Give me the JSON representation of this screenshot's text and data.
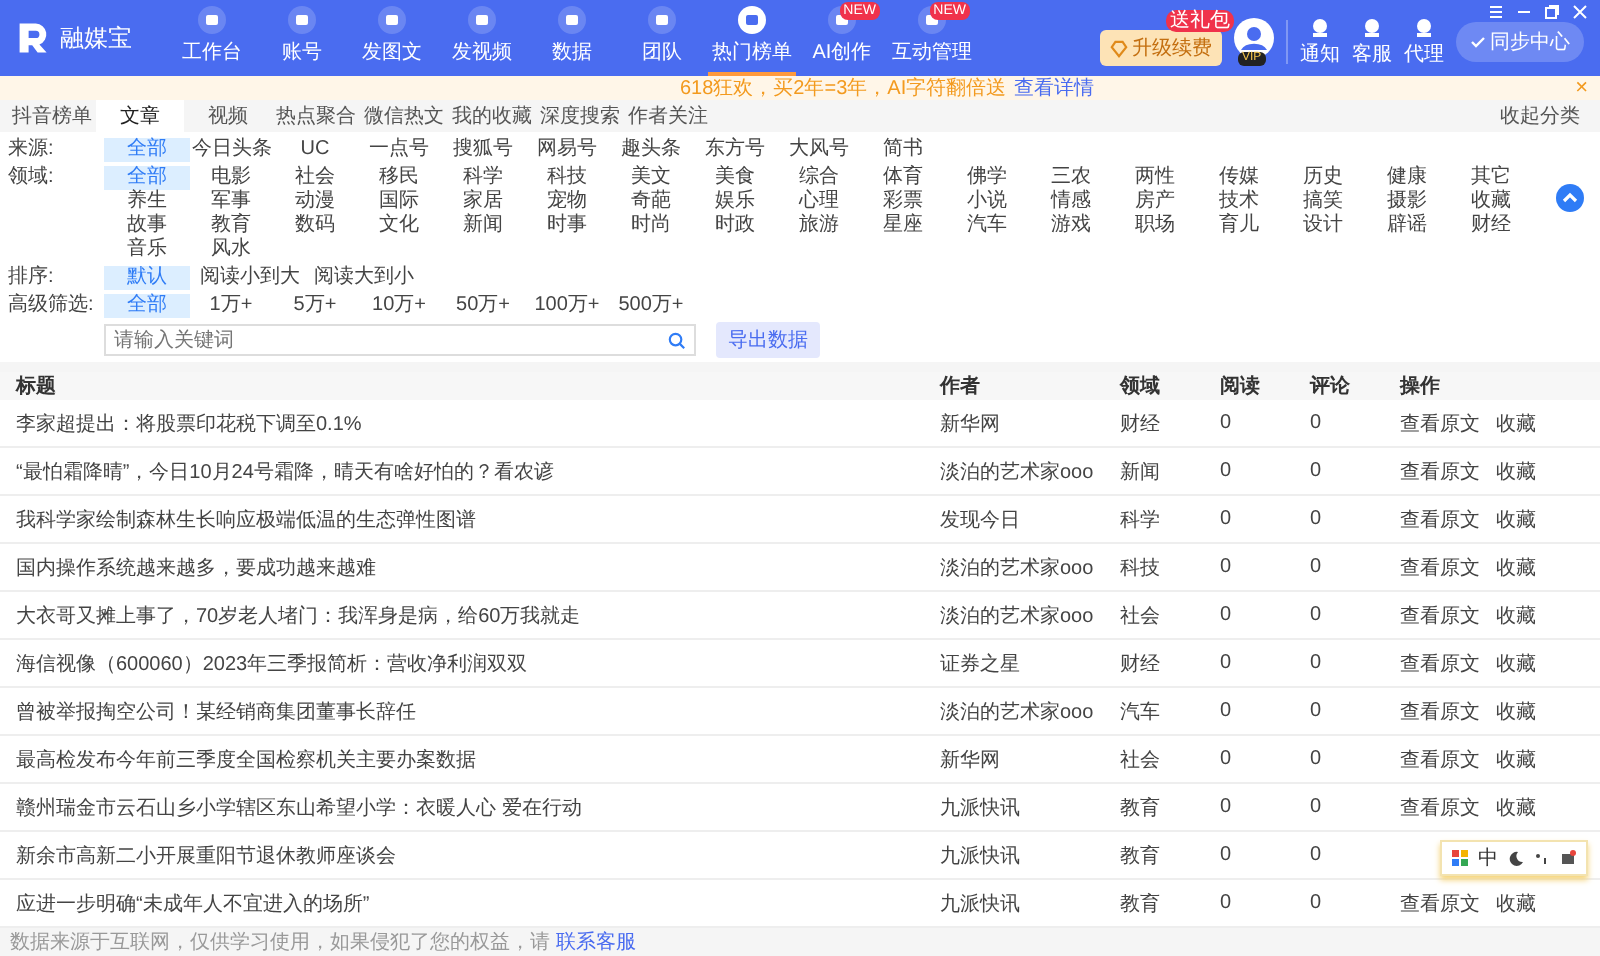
{
  "app": {
    "logo_text": "融媒宝"
  },
  "nav": [
    {
      "label": "工作台",
      "selected": false
    },
    {
      "label": "账号",
      "selected": false
    },
    {
      "label": "发图文",
      "selected": false
    },
    {
      "label": "发视频",
      "selected": false
    },
    {
      "label": "数据",
      "selected": false
    },
    {
      "label": "团队",
      "selected": false
    },
    {
      "label": "热门榜单",
      "selected": true
    },
    {
      "label": "AI创作",
      "selected": false,
      "badge": "NEW"
    },
    {
      "label": "互动管理",
      "selected": false,
      "badge": "NEW"
    }
  ],
  "upgrade": {
    "label": "升级续费",
    "badge": "送礼包"
  },
  "avatar": {
    "badge": "VIP"
  },
  "tools": [
    "通知",
    "客服",
    "代理"
  ],
  "sync_button": "同步中心",
  "notice": {
    "text": "618狂欢，买2年=3年，AI字符翻倍送",
    "link": "查看详情",
    "close": "×"
  },
  "tabs": [
    {
      "label": "抖音榜单",
      "selected": false
    },
    {
      "label": "文章",
      "selected": true
    },
    {
      "label": "视频",
      "selected": false
    },
    {
      "label": "热点聚合",
      "selected": false
    },
    {
      "label": "微信热文",
      "selected": false
    },
    {
      "label": "我的收藏",
      "selected": false
    },
    {
      "label": "深度搜索",
      "selected": false
    },
    {
      "label": "作者关注",
      "selected": false
    }
  ],
  "collapse_link": "收起分类",
  "filters": [
    {
      "label": "来源:",
      "kind": "grid",
      "options": [
        {
          "label": "全部",
          "selected": true
        },
        {
          "label": "今日头条",
          "selected": false
        },
        {
          "label": "UC",
          "selected": false
        },
        {
          "label": "一点号",
          "selected": false
        },
        {
          "label": "搜狐号",
          "selected": false
        },
        {
          "label": "网易号",
          "selected": false
        },
        {
          "label": "趣头条",
          "selected": false
        },
        {
          "label": "东方号",
          "selected": false
        },
        {
          "label": "大风号",
          "selected": false
        },
        {
          "label": "简书",
          "selected": false
        }
      ]
    },
    {
      "label": "领域:",
      "kind": "grid",
      "options": [
        {
          "label": "全部",
          "selected": true
        },
        {
          "label": "电影",
          "selected": false
        },
        {
          "label": "社会",
          "selected": false
        },
        {
          "label": "移民",
          "selected": false
        },
        {
          "label": "科学",
          "selected": false
        },
        {
          "label": "科技",
          "selected": false
        },
        {
          "label": "美文",
          "selected": false
        },
        {
          "label": "美食",
          "selected": false
        },
        {
          "label": "综合",
          "selected": false
        },
        {
          "label": "体育",
          "selected": false
        },
        {
          "label": "佛学",
          "selected": false
        },
        {
          "label": "三农",
          "selected": false
        },
        {
          "label": "两性",
          "selected": false
        },
        {
          "label": "传媒",
          "selected": false
        },
        {
          "label": "历史",
          "selected": false
        },
        {
          "label": "健康",
          "selected": false
        },
        {
          "label": "其它",
          "selected": false
        },
        {
          "label": "养生",
          "selected": false
        },
        {
          "label": "军事",
          "selected": false
        },
        {
          "label": "动漫",
          "selected": false
        },
        {
          "label": "国际",
          "selected": false
        },
        {
          "label": "家居",
          "selected": false
        },
        {
          "label": "宠物",
          "selected": false
        },
        {
          "label": "奇葩",
          "selected": false
        },
        {
          "label": "娱乐",
          "selected": false
        },
        {
          "label": "心理",
          "selected": false
        },
        {
          "label": "彩票",
          "selected": false
        },
        {
          "label": "小说",
          "selected": false
        },
        {
          "label": "情感",
          "selected": false
        },
        {
          "label": "房产",
          "selected": false
        },
        {
          "label": "技术",
          "selected": false
        },
        {
          "label": "搞笑",
          "selected": false
        },
        {
          "label": "摄影",
          "selected": false
        },
        {
          "label": "收藏",
          "selected": false
        },
        {
          "label": "故事",
          "selected": false
        },
        {
          "label": "教育",
          "selected": false
        },
        {
          "label": "数码",
          "selected": false
        },
        {
          "label": "文化",
          "selected": false
        },
        {
          "label": "新闻",
          "selected": false
        },
        {
          "label": "时事",
          "selected": false
        },
        {
          "label": "时尚",
          "selected": false
        },
        {
          "label": "时政",
          "selected": false
        },
        {
          "label": "旅游",
          "selected": false
        },
        {
          "label": "星座",
          "selected": false
        },
        {
          "label": "汽车",
          "selected": false
        },
        {
          "label": "游戏",
          "selected": false
        },
        {
          "label": "职场",
          "selected": false
        },
        {
          "label": "育儿",
          "selected": false
        },
        {
          "label": "设计",
          "selected": false
        },
        {
          "label": "辟谣",
          "selected": false
        },
        {
          "label": "财经",
          "selected": false
        },
        {
          "label": "音乐",
          "selected": false
        },
        {
          "label": "风水",
          "selected": false
        }
      ]
    },
    {
      "label": "排序:",
      "kind": "flow",
      "options": [
        {
          "label": "默认",
          "selected": true
        },
        {
          "label": "阅读小到大",
          "selected": false
        },
        {
          "label": "阅读大到小",
          "selected": false
        }
      ]
    },
    {
      "label": "高级筛选:",
      "kind": "grid",
      "options": [
        {
          "label": "全部",
          "selected": true
        },
        {
          "label": "1万+",
          "selected": false
        },
        {
          "label": "5万+",
          "selected": false
        },
        {
          "label": "10万+",
          "selected": false
        },
        {
          "label": "50万+",
          "selected": false
        },
        {
          "label": "100万+",
          "selected": false
        },
        {
          "label": "500万+",
          "selected": false
        }
      ]
    }
  ],
  "search": {
    "placeholder": "请输入关键词"
  },
  "export_button": "导出数据",
  "table": {
    "columns": [
      "标题",
      "作者",
      "领域",
      "阅读",
      "评论",
      "操作"
    ],
    "rows": [
      {
        "title": "李家超提出：将股票印花税下调至0.1%",
        "author": "新华网",
        "domain": "财经",
        "reads": "0",
        "comments": "0",
        "actions": [
          "查看原文",
          "收藏"
        ]
      },
      {
        "title": "“最怕霜降晴”，今日10月24号霜降，晴天有啥好怕的？看农谚",
        "author": "淡泊的艺术家ooo",
        "domain": "新闻",
        "reads": "0",
        "comments": "0",
        "actions": [
          "查看原文",
          "收藏"
        ]
      },
      {
        "title": "我科学家绘制森林生长响应极端低温的生态弹性图谱",
        "author": "发现今日",
        "domain": "科学",
        "reads": "0",
        "comments": "0",
        "actions": [
          "查看原文",
          "收藏"
        ]
      },
      {
        "title": "国内操作系统越来越多，要成功越来越难",
        "author": "淡泊的艺术家ooo",
        "domain": "科技",
        "reads": "0",
        "comments": "0",
        "actions": [
          "查看原文",
          "收藏"
        ]
      },
      {
        "title": "大衣哥又摊上事了，70岁老人堵门：我浑身是病，给60万我就走",
        "author": "淡泊的艺术家ooo",
        "domain": "社会",
        "reads": "0",
        "comments": "0",
        "actions": [
          "查看原文",
          "收藏"
        ]
      },
      {
        "title": "海信视像（600060）2023年三季报简析：营收净利润双双",
        "author": "证券之星",
        "domain": "财经",
        "reads": "0",
        "comments": "0",
        "actions": [
          "查看原文",
          "收藏"
        ]
      },
      {
        "title": "曾被举报掏空公司！某经销商集团董事长辞任",
        "author": "淡泊的艺术家ooo",
        "domain": "汽车",
        "reads": "0",
        "comments": "0",
        "actions": [
          "查看原文",
          "收藏"
        ]
      },
      {
        "title": "最高检发布今年前三季度全国检察机关主要办案数据",
        "author": "新华网",
        "domain": "社会",
        "reads": "0",
        "comments": "0",
        "actions": [
          "查看原文",
          "收藏"
        ]
      },
      {
        "title": "赣州瑞金市云石山乡小学辖区东山希望小学：衣暖人心 爱在行动",
        "author": "九派快讯",
        "domain": "教育",
        "reads": "0",
        "comments": "0",
        "actions": [
          "查看原文",
          "收藏"
        ]
      },
      {
        "title": "新余市高新二小开展重阳节退休教师座谈会",
        "author": "九派快讯",
        "domain": "教育",
        "reads": "0",
        "comments": "0"
      },
      {
        "title": "应进一步明确“未成年人不宜进入的场所”",
        "author": "九派快讯",
        "domain": "教育",
        "reads": "0",
        "comments": "0",
        "actions": [
          "查看原文",
          "收藏"
        ]
      }
    ]
  },
  "footer": {
    "text": "数据来源于互联网，仅供学习使用，如果侵犯了您的权益，请",
    "link": "联系客服"
  },
  "ime_toolbar": {
    "label": "中"
  }
}
